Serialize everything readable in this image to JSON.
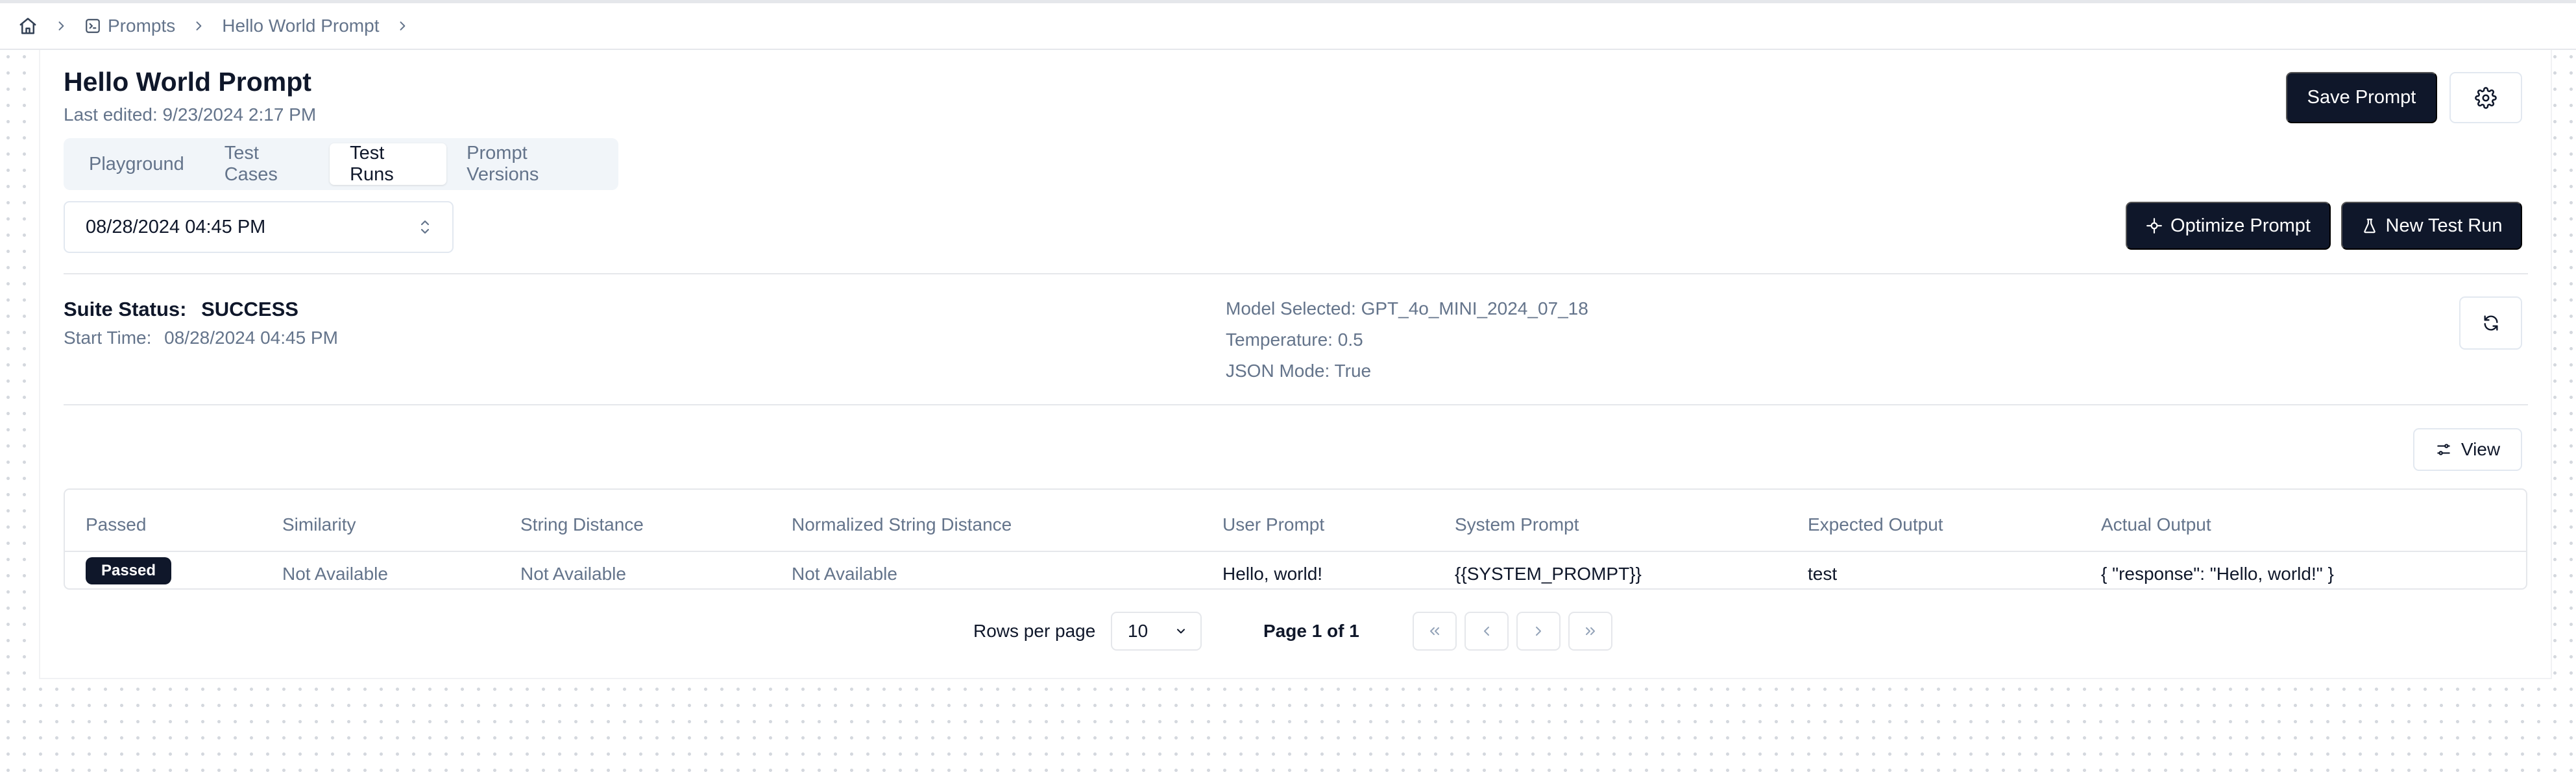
{
  "breadcrumb": {
    "home_icon": "home-icon",
    "items": [
      {
        "label": "Prompts",
        "icon": "terminal-icon"
      },
      {
        "label": "Hello World Prompt"
      }
    ]
  },
  "header": {
    "title": "Hello World Prompt",
    "last_edited": "Last edited: 9/23/2024 2:17 PM",
    "save_label": "Save Prompt",
    "settings_icon": "gear-icon"
  },
  "tabs": [
    {
      "label": "Playground",
      "active": false
    },
    {
      "label": "Test Cases",
      "active": false
    },
    {
      "label": "Test Runs",
      "active": true
    },
    {
      "label": "Prompt Versions",
      "active": false
    }
  ],
  "run_select": {
    "value": "08/28/2024 04:45 PM"
  },
  "actions": {
    "optimize_label": "Optimize Prompt",
    "new_run_label": "New Test Run"
  },
  "suite": {
    "status_label": "Suite Status:",
    "status_value": "SUCCESS",
    "start_label": "Start Time:",
    "start_value": "08/28/2024 04:45 PM",
    "model": "Model Selected: GPT_4o_MINI_2024_07_18",
    "temperature": "Temperature: 0.5",
    "json_mode": "JSON Mode: True"
  },
  "view_label": "View",
  "table": {
    "columns": [
      "Passed",
      "Similarity",
      "String Distance",
      "Normalized String Distance",
      "User Prompt",
      "System Prompt",
      "Expected Output",
      "Actual Output"
    ],
    "rows": [
      {
        "passed": "Passed",
        "similarity": "Not Available",
        "string_distance": "Not Available",
        "normalized_string_distance": "Not Available",
        "user_prompt": "Hello, world!",
        "system_prompt": "{{SYSTEM_PROMPT}}",
        "expected_output": "test",
        "actual_output": "{ \"response\": \"Hello, world!\" }"
      }
    ]
  },
  "pagination": {
    "rows_per_page_label": "Rows per page",
    "rows_per_page_value": "10",
    "page_info": "Page 1 of 1"
  }
}
